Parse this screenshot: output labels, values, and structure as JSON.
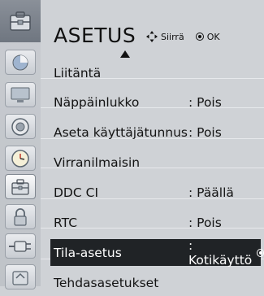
{
  "header": {
    "title": "ASETUS",
    "nav_move_label": "Siirrä",
    "nav_ok_label": "OK"
  },
  "sidebar": {
    "items": [
      {
        "icon": "picture-icon"
      },
      {
        "icon": "monitor-icon"
      },
      {
        "icon": "speaker-icon"
      },
      {
        "icon": "clock-icon"
      },
      {
        "icon": "settings-toolbox-icon",
        "active": true
      },
      {
        "icon": "lock-icon"
      },
      {
        "icon": "input-plug-icon"
      },
      {
        "icon": "usb-icon"
      }
    ]
  },
  "menu": {
    "items": [
      {
        "label": "Liitäntä",
        "value": ""
      },
      {
        "label": "Näppäinlukko",
        "value": ": Pois"
      },
      {
        "label": "Aseta käyttäjätunnus",
        "value": ": Pois"
      },
      {
        "label": "Virranilmaisin",
        "value": ""
      },
      {
        "label": "DDC CI",
        "value": ": Päällä"
      },
      {
        "label": "RTC",
        "value": ": Pois"
      },
      {
        "label": "Tila-asetus",
        "value": ": Kotikäyttö",
        "selected": true
      },
      {
        "label": "Tehdasasetukset",
        "value": ""
      }
    ]
  },
  "colors": {
    "background": "#cfd2d6",
    "selected_row": "#202326",
    "text": "#141414"
  }
}
